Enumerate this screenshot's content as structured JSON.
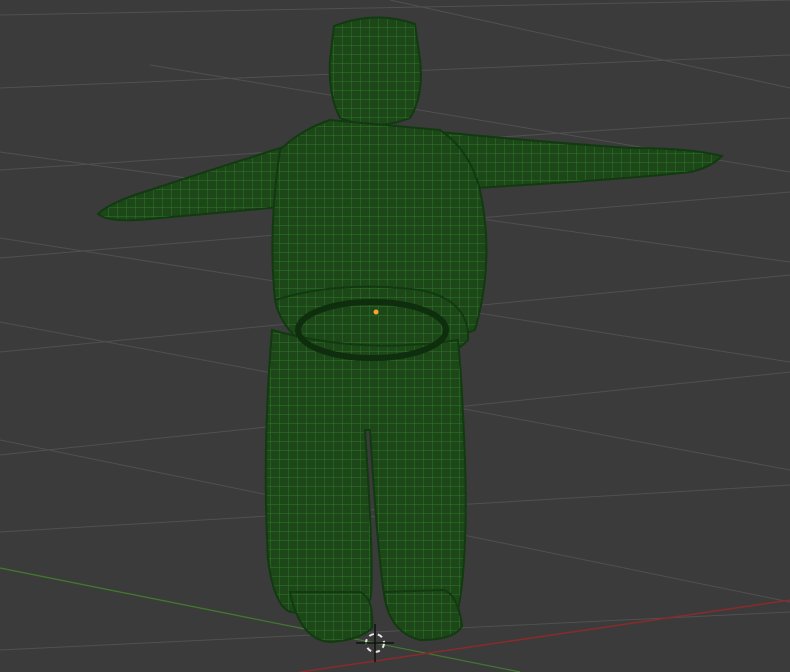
{
  "viewport": {
    "background_color": "#3b3b3b",
    "grid_color": "#4f4f4f",
    "x_axis_color": "#8b2a2a",
    "y_axis_color": "#3f7d2f",
    "wire_color": "#1f5a1c",
    "fill_color": "#1a3e17",
    "origin_color": "#ffa033",
    "cursor_color": "#e8e8e8",
    "model": "t-pose-character-wireframe",
    "shading_mode": "wireframe"
  }
}
